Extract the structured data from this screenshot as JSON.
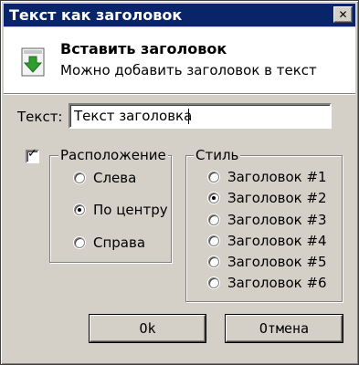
{
  "window": {
    "title": "Текст как заголовок",
    "close_label": "✕"
  },
  "header": {
    "title": "Вставить заголовок",
    "subtitle": "Можно добавить заголовок в текст",
    "icon": "green-down-arrow-document-icon"
  },
  "text_field": {
    "label": "Текст:",
    "value": "Текст заголовка"
  },
  "position_group": {
    "enabled": true,
    "check_mark": "✓",
    "label": "Расположение",
    "options": [
      "Слева",
      "По центру",
      "Справа"
    ],
    "selected": "По центру"
  },
  "style_group": {
    "label": "Стиль",
    "options": [
      "Заголовок #1",
      "Заголовок #2",
      "Заголовок #3",
      "Заголовок #4",
      "Заголовок #5",
      "Заголовок #6"
    ],
    "selected": "Заголовок #2"
  },
  "buttons": {
    "ok": "Ok",
    "cancel": "Отмена"
  },
  "colors": {
    "titlebar": "#0a246a",
    "face": "#d4d0c8",
    "icon_green": "#2f9e2f"
  }
}
